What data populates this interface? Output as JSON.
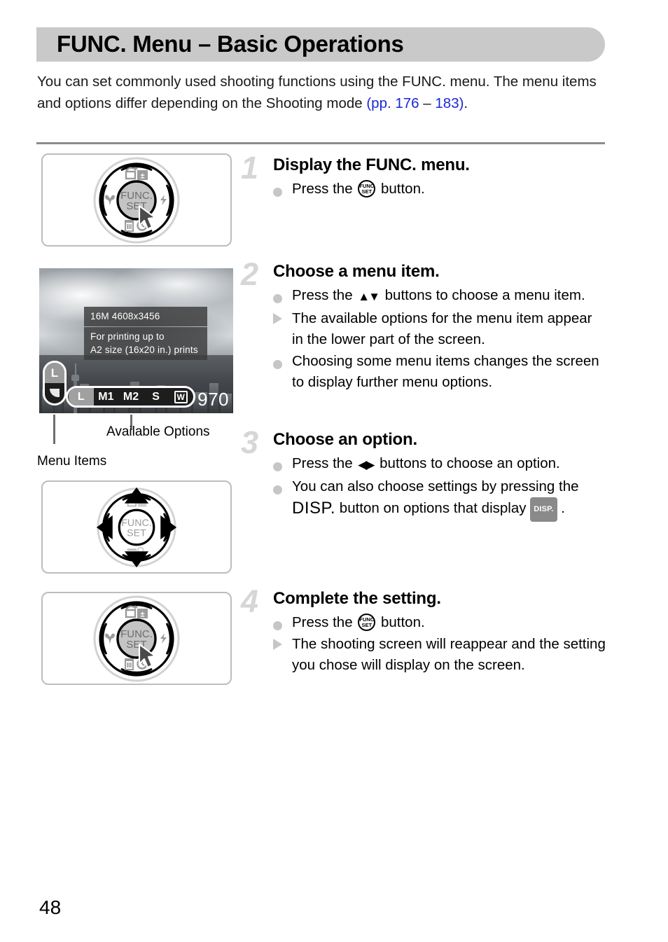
{
  "header": {
    "title": "FUNC. Menu – Basic Operations"
  },
  "intro": {
    "line1": "You can set commonly used shooting functions using the FUNC. menu.",
    "line2_before": "The menu items and options differ depending on the Shooting mode ",
    "link1": "(pp. 176",
    "line2_mid": " – ",
    "link2": "183)",
    "line2_after": "."
  },
  "figures": {
    "dial_center_top": "FUNC.",
    "dial_center_bottom": "SET",
    "icons": {
      "top_left": "display-rotate-icon",
      "top_right": "exposure-compensation-icon",
      "left": "macro-flower-icon",
      "right": "flash-bolt-icon",
      "bottom_left": "trash-icon",
      "bottom_right": "self-timer-icon"
    }
  },
  "lcd": {
    "tip_title": "16M 4608x3456",
    "tip_body": "For printing up to\nA2 size (16x20 in.) prints",
    "menu_item_selected": "L",
    "options": [
      {
        "label": "L",
        "selected": true,
        "boxed": false
      },
      {
        "label": "M1",
        "selected": false,
        "boxed": false
      },
      {
        "label": "M2",
        "selected": false,
        "boxed": false
      },
      {
        "label": "S",
        "selected": false,
        "boxed": false
      },
      {
        "label": "W",
        "selected": false,
        "boxed": true
      }
    ],
    "shots_remaining": "970"
  },
  "callouts": {
    "available_options": "Available Options",
    "menu_items": "Menu Items"
  },
  "steps": [
    {
      "number": "1",
      "title": "Display the FUNC. menu.",
      "lines": [
        {
          "marker": "dot",
          "before": "Press the ",
          "glyph": "funcset",
          "after": " button."
        }
      ]
    },
    {
      "number": "2",
      "title": "Choose a menu item.",
      "lines": [
        {
          "marker": "dot",
          "before": "Press the ",
          "glyph": "updown",
          "after": " buttons to choose a menu item."
        },
        {
          "marker": "triangle",
          "before": "The available options for the menu item appear in the lower part of the screen.",
          "glyph": "",
          "after": ""
        },
        {
          "marker": "dot",
          "before": "Choosing some menu items changes the screen to display further menu options.",
          "glyph": "",
          "after": ""
        }
      ]
    },
    {
      "number": "3",
      "title": "Choose an option.",
      "lines": [
        {
          "marker": "dot",
          "before": "Press the ",
          "glyph": "leftright",
          "after": " buttons to choose an option."
        },
        {
          "marker": "dot",
          "before": "You can also choose settings by pressing the ",
          "glyph": "disp-text",
          "after": " button on options that display ",
          "glyph2": "disp-badge",
          "after2": " ."
        }
      ]
    },
    {
      "number": "4",
      "title": "Complete the setting.",
      "lines": [
        {
          "marker": "dot",
          "before": "Press the ",
          "glyph": "funcset",
          "after": " button."
        },
        {
          "marker": "triangle",
          "before": "The shooting screen will reappear and the setting you chose will display on the screen.",
          "glyph": "",
          "after": ""
        }
      ]
    }
  ],
  "glyph_labels": {
    "disp_text": "DISP.",
    "disp_badge": "DISP.",
    "updown": "▲▼",
    "leftright": "◀▶"
  },
  "footer": {
    "page_number": "48"
  },
  "colors": {
    "header_bar": "#c9c9c9",
    "link": "#1a27d8",
    "step_number": "#d6d6d6",
    "marker": "#c6c6c6",
    "rule": "#8c8c8c"
  }
}
